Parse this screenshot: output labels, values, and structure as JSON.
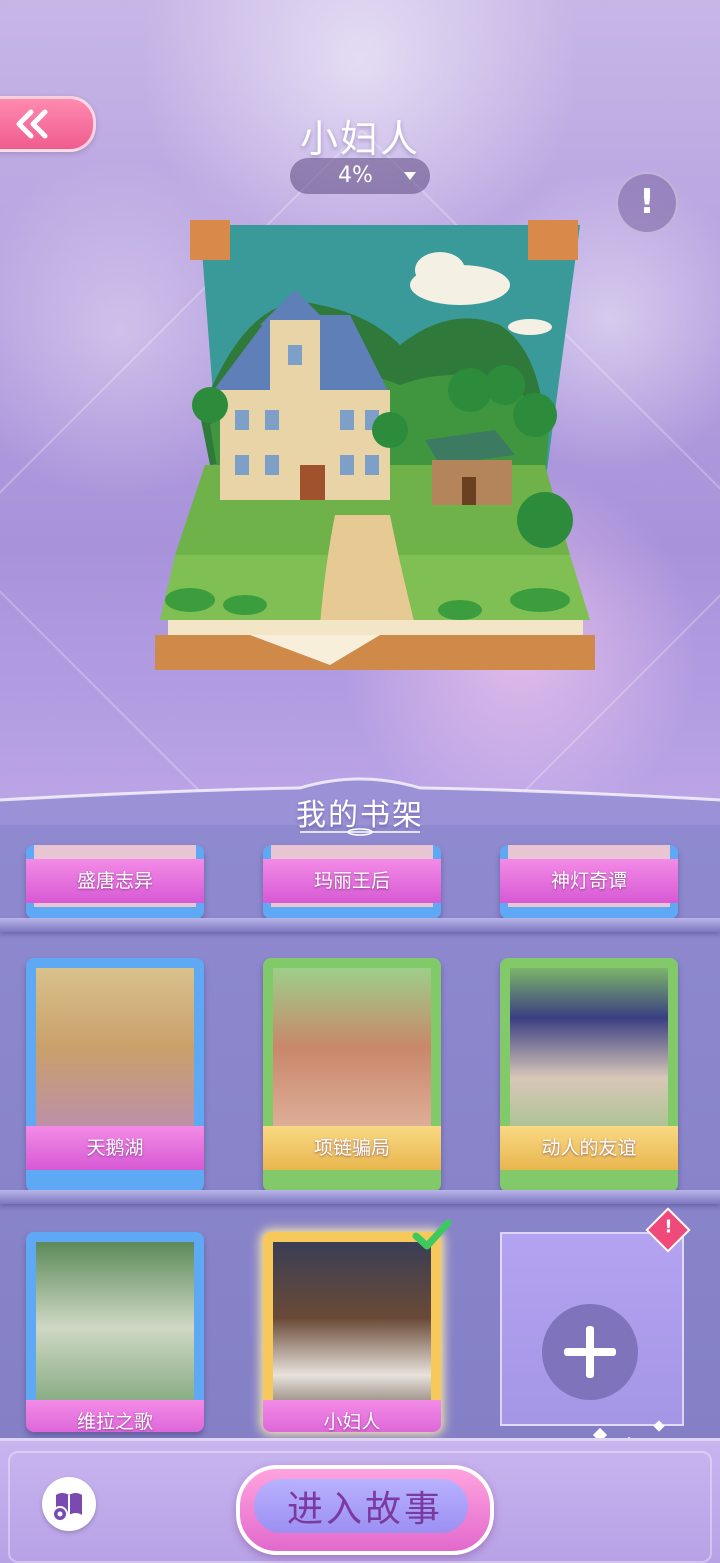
{
  "header": {
    "back_label": "back",
    "story_title": "小妇人",
    "progress": "4%",
    "alert_symbol": "!"
  },
  "shelf": {
    "title": "我的书架",
    "rows": [
      [
        {
          "label": "盛唐志异",
          "band": "pink",
          "frame": "#5fa9f4"
        },
        {
          "label": "玛丽王后",
          "band": "pink",
          "frame": "#5fa9f4"
        },
        {
          "label": "神灯奇谭",
          "band": "pink",
          "frame": "#5fa9f4"
        }
      ],
      [
        {
          "label": "天鹅湖",
          "band": "pink",
          "frame": "#5fa9f4"
        },
        {
          "label": "项链骗局",
          "band": "gold",
          "frame": "#82c96a"
        },
        {
          "label": "动人的友谊",
          "band": "gold",
          "frame": "#82c96a"
        }
      ],
      [
        {
          "label": "维拉之歌",
          "band": "pink",
          "frame": "#5fa9f4"
        },
        {
          "label": "小妇人",
          "band": "pink",
          "frame": "#f7c85a",
          "selected": true
        }
      ]
    ],
    "add_badge": "!"
  },
  "footer": {
    "enter_label": "进入故事"
  },
  "colors": {
    "accent_pink": "#ef5c8e",
    "selected_check": "#3fc85d"
  }
}
